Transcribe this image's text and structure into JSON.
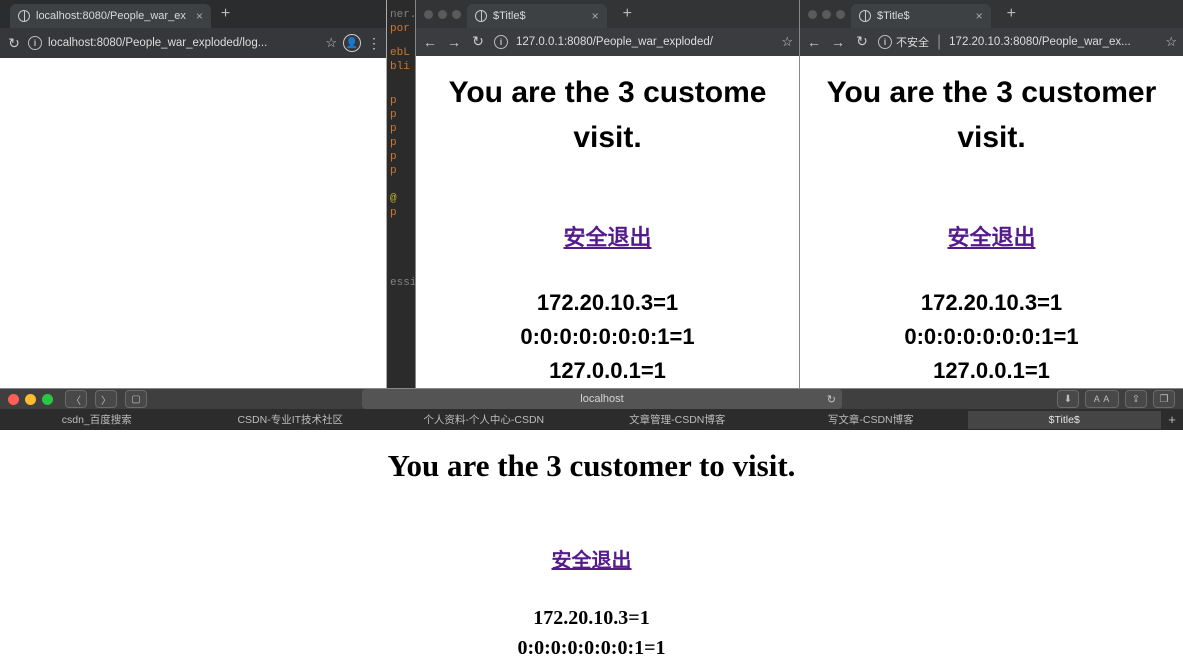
{
  "chrome1": {
    "tab_title": "localhost:8080/People_war_ex",
    "url": "localhost:8080/People_war_exploded/log..."
  },
  "code_strip": {
    "l1": "ner.j",
    "l2": "por",
    "l3": "ebL",
    "l4": "bli",
    "l5": "p",
    "l6": "p",
    "l7": "p",
    "l8": "p",
    "l9": "p",
    "l10": "p",
    "l11": "@",
    "l12": "p",
    "l13": "essio"
  },
  "chrome2": {
    "tab_title": "$Title$",
    "url": "127.0.0.1:8080/People_war_exploded/",
    "heading": "You are the 3 custome visit.",
    "link": "安全退出 ",
    "ip1": "172.20.10.3=1",
    "ip2": "0:0:0:0:0:0:0:1=1",
    "ip3": "127.0.0.1=1"
  },
  "chrome3": {
    "tab_title": "$Title$",
    "insecure_label": "不安全",
    "url": "172.20.10.3:8080/People_war_ex...",
    "heading": "You are the 3 customer visit.",
    "link": "安全退出 ",
    "ip1": "172.20.10.3=1",
    "ip2": "0:0:0:0:0:0:0:1=1",
    "ip3": "127.0.0.1=1"
  },
  "safari": {
    "url": "localhost",
    "favorites": {
      "f1": "csdn_百度搜索",
      "f2": "CSDN-专业IT技术社区",
      "f3": "个人资料-个人中心-CSDN",
      "f4": "文章管理-CSDN博客",
      "f5": "写文章-CSDN博客",
      "f6": "$Title$"
    },
    "heading": "You are the 3 customer to visit.",
    "link": "安全退出 ",
    "ip1": "172.20.10.3=1",
    "ip2": "0:0:0:0:0:0:0:1=1"
  }
}
